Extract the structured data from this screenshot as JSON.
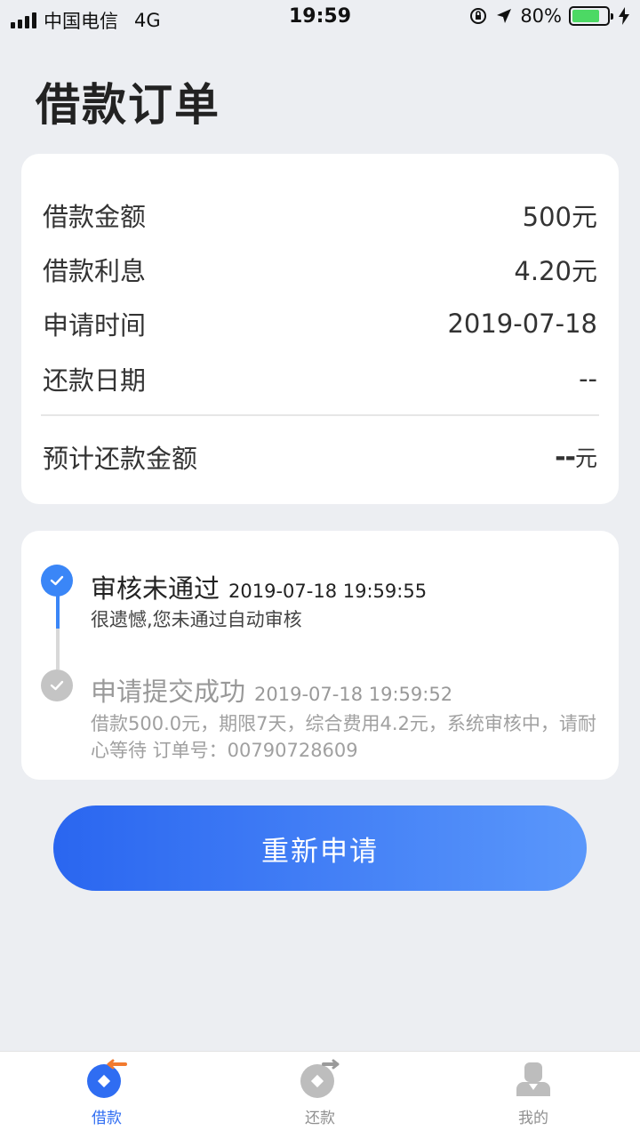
{
  "status_bar": {
    "carrier": "中国电信",
    "network": "4G",
    "time": "19:59",
    "battery": "80%",
    "battery_level": 0.8
  },
  "page": {
    "title": "借款订单"
  },
  "summary": {
    "rows": [
      {
        "label": "借款金额",
        "value": "500元"
      },
      {
        "label": "借款利息",
        "value": "4.20元"
      },
      {
        "label": "申请时间",
        "value": "2019-07-18"
      },
      {
        "label": "还款日期",
        "value": "--"
      }
    ],
    "total": {
      "label": "预计还款金额",
      "value": "--",
      "unit": "元"
    }
  },
  "timeline": [
    {
      "title": "审核未通过",
      "time": "2019-07-18 19:59:55",
      "desc": "很遗憾,您未通过自动审核",
      "state": "active"
    },
    {
      "title": "申请提交成功",
      "time": "2019-07-18 19:59:52",
      "desc": "借款500.0元，期限7天，综合费用4.2元，系统审核中，请耐心等待 订单号：00790728609",
      "state": "done"
    }
  ],
  "actions": {
    "reapply": "重新申请"
  },
  "tabbar": {
    "items": [
      {
        "label": "借款",
        "icon": "borrow-icon",
        "active": true
      },
      {
        "label": "还款",
        "icon": "repay-icon",
        "active": false
      },
      {
        "label": "我的",
        "icon": "profile-icon",
        "active": false
      }
    ],
    "active_color": "#2f6df2"
  }
}
